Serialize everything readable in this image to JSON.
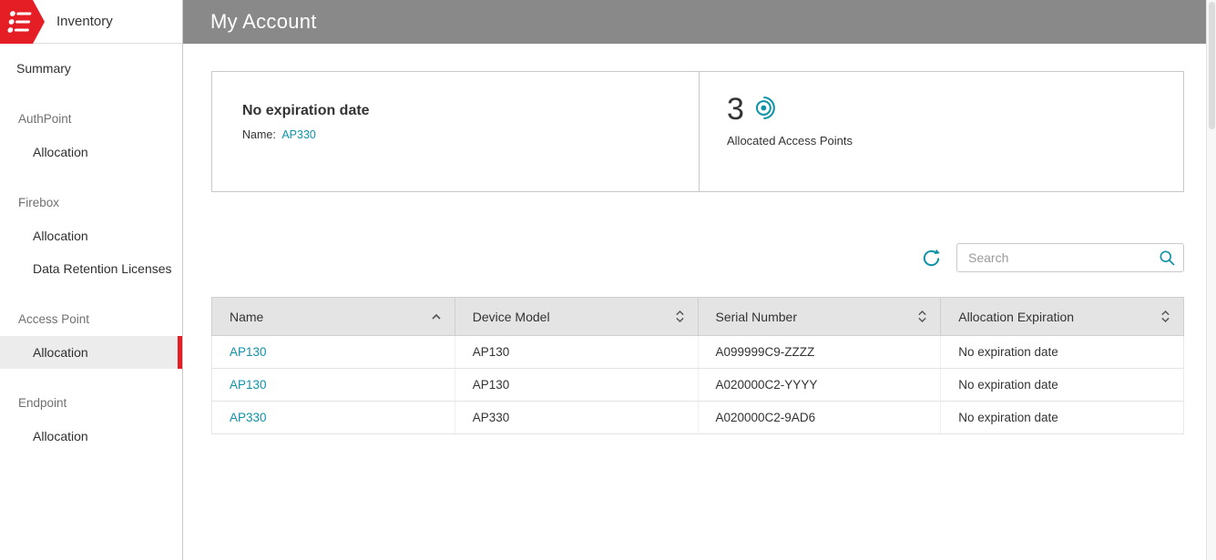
{
  "header": {
    "title": "My Account"
  },
  "sidebar": {
    "title": "Inventory",
    "items": [
      {
        "label": "Summary",
        "type": "item"
      },
      {
        "label": "AuthPoint",
        "type": "section"
      },
      {
        "label": "Allocation",
        "type": "subitem"
      },
      {
        "label": "Firebox",
        "type": "section"
      },
      {
        "label": "Allocation",
        "type": "subitem"
      },
      {
        "label": "Data Retention Licenses",
        "type": "subitem"
      },
      {
        "label": "Access Point",
        "type": "section"
      },
      {
        "label": "Allocation",
        "type": "subitem",
        "selected": true
      },
      {
        "label": "Endpoint",
        "type": "section"
      },
      {
        "label": "Allocation",
        "type": "subitem"
      }
    ]
  },
  "summary_cards": {
    "expiration_card": {
      "title": "No expiration date",
      "name_label": "Name:",
      "name_value": "AP330"
    },
    "allocated_card": {
      "count": "3",
      "label": "Allocated Access Points"
    }
  },
  "toolbar": {
    "search_placeholder": "Search"
  },
  "table": {
    "columns": [
      {
        "label": "Name",
        "sort": "ascending"
      },
      {
        "label": "Device Model",
        "sort": "sortable"
      },
      {
        "label": "Serial Number",
        "sort": "sortable"
      },
      {
        "label": "Allocation Expiration",
        "sort": "sortable"
      }
    ],
    "rows": [
      {
        "name": "AP130",
        "device_model": "AP130",
        "serial_number": "A099999C9-ZZZZ",
        "allocation_expiration": "No expiration date"
      },
      {
        "name": "AP130",
        "device_model": "AP130",
        "serial_number": "A020000C2-YYYY",
        "allocation_expiration": "No expiration date"
      },
      {
        "name": "AP330",
        "device_model": "AP330",
        "serial_number": "A020000C2-9AD6",
        "allocation_expiration": "No expiration date"
      }
    ]
  },
  "icons": {
    "logo": "inventory-list-pennant",
    "refresh": "circular-arrow",
    "search": "magnifier",
    "access_point": "broadcast-dot",
    "sort_asc": "chevron-up",
    "sort_both": "chevron-up-down"
  },
  "colors": {
    "brand_red": "#e51e25",
    "accent_teal": "#0f93a8",
    "header_gray": "#898989"
  }
}
